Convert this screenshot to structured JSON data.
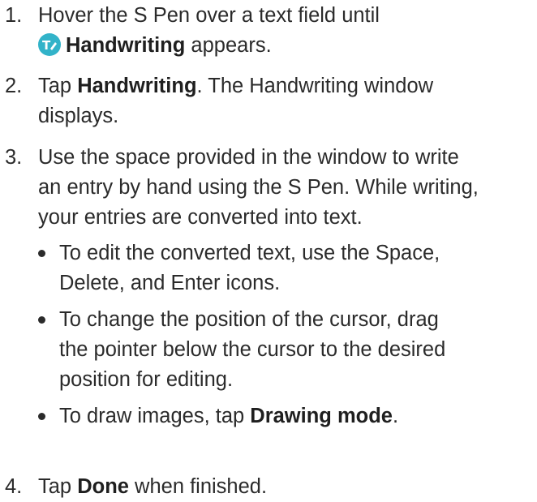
{
  "steps": [
    {
      "number": "1.",
      "line1": "Hover the S Pen over a text field until",
      "icon": "handwriting-icon",
      "icon_color": "#32b3c9",
      "bold": "Handwriting",
      "after": " appears."
    },
    {
      "number": "2.",
      "pre": "Tap ",
      "bold": "Handwriting",
      "after": ". The Handwriting window",
      "line2": "displays."
    },
    {
      "number": "3.",
      "line1": "Use the space provided in the window to write",
      "line2": "an entry by hand using the S Pen. While writing,",
      "line3": "your entries are converted into text."
    },
    {
      "number": "4.",
      "pre": "Tap ",
      "bold": "Done",
      "after": " when finished."
    }
  ],
  "bullets": [
    {
      "line1": "To edit the converted text, use the Space,",
      "line2": "Delete, and Enter icons."
    },
    {
      "line1": "To change the position of the cursor, drag",
      "line2": "the pointer below the cursor to the desired",
      "line3": "position for editing."
    },
    {
      "pre": "To draw images, tap ",
      "bold": "Drawing mode",
      "after": "."
    }
  ]
}
